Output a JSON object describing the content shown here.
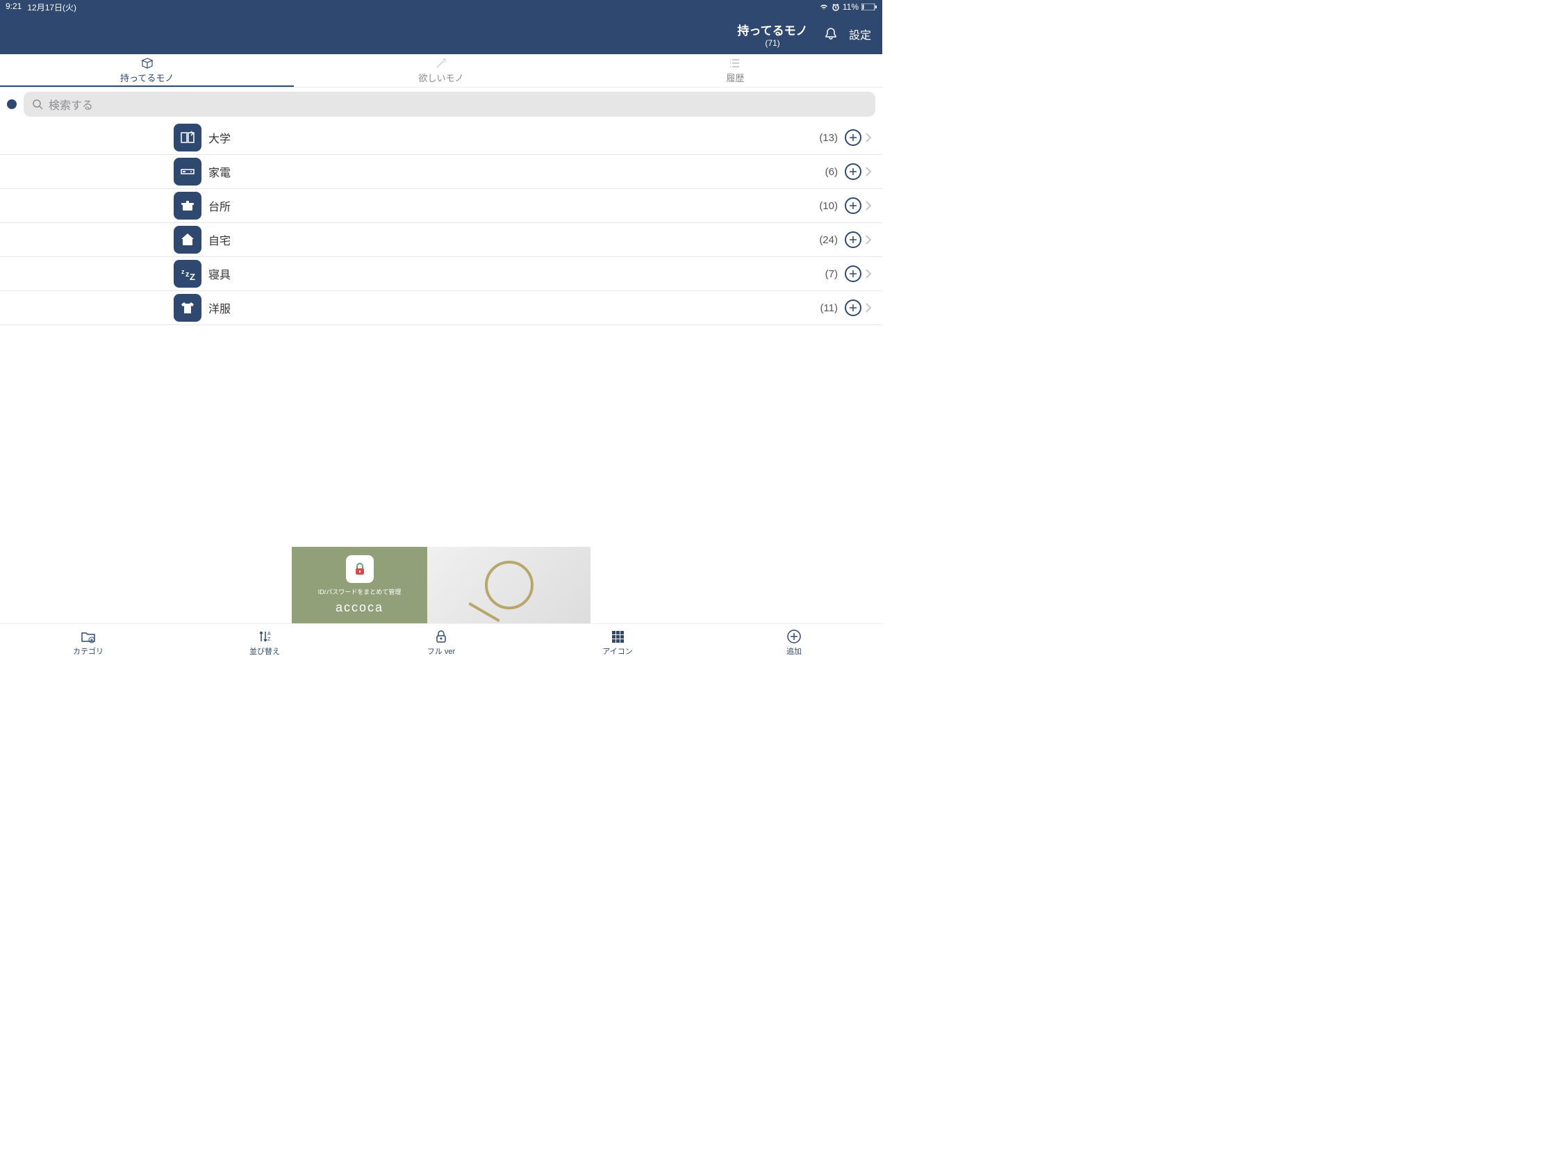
{
  "status": {
    "time": "9:21",
    "date": "12月17日(火)",
    "battery": "11%"
  },
  "header": {
    "title": "持ってるモノ",
    "count": "(71)",
    "settings": "設定"
  },
  "tabs": [
    {
      "label": "持ってるモノ"
    },
    {
      "label": "欲しいモノ"
    },
    {
      "label": "履歴"
    }
  ],
  "search": {
    "placeholder": "検索する"
  },
  "categories": [
    {
      "label": "大学",
      "count": "(13)",
      "icon": "book"
    },
    {
      "label": "家電",
      "count": "(6)",
      "icon": "appliance"
    },
    {
      "label": "台所",
      "count": "(10)",
      "icon": "pot"
    },
    {
      "label": "自宅",
      "count": "(24)",
      "icon": "home"
    },
    {
      "label": "寝具",
      "count": "(7)",
      "icon": "sleep"
    },
    {
      "label": "洋服",
      "count": "(11)",
      "icon": "shirt"
    }
  ],
  "banner": {
    "subtitle": "ID/パスワードをまとめて管理",
    "title": "accoca"
  },
  "bottom": [
    {
      "label": "カテゴリ"
    },
    {
      "label": "並び替え"
    },
    {
      "label": "フル ver"
    },
    {
      "label": "アイコン"
    },
    {
      "label": "追加"
    }
  ]
}
